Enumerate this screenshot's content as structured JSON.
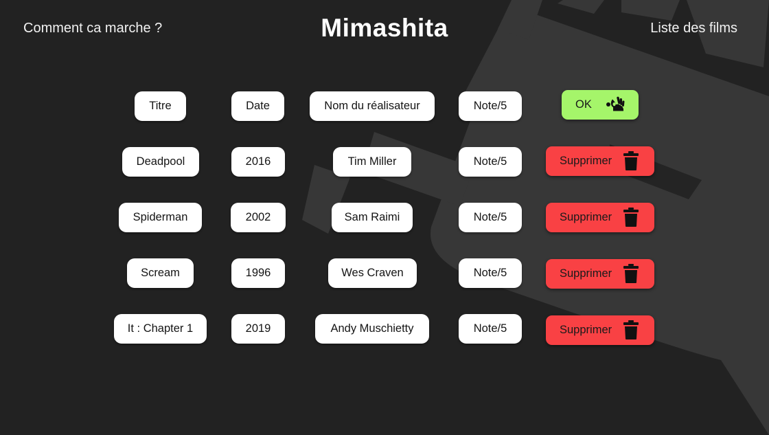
{
  "header": {
    "nav_left": "Comment ca marche ?",
    "brand": "Mimashita",
    "nav_right": "Liste des films"
  },
  "form": {
    "title_placeholder": "Titre",
    "date_placeholder": "Date",
    "director_placeholder": "Nom du réalisateur",
    "rating_placeholder": "Note/5",
    "submit_label": "OK",
    "submit_icon": "ok-hand-icon"
  },
  "films": [
    {
      "title": "Deadpool",
      "year": "2016",
      "director": "Tim Miller",
      "rating": "Note/5",
      "delete_label": "Supprimer"
    },
    {
      "title": "Spiderman",
      "year": "2002",
      "director": "Sam Raimi",
      "rating": "Note/5",
      "delete_label": "Supprimer"
    },
    {
      "title": "Scream",
      "year": "1996",
      "director": "Wes Craven",
      "rating": "Note/5",
      "delete_label": "Supprimer"
    },
    {
      "title": "It : Chapter 1",
      "year": "2019",
      "director": "Andy Muschietty",
      "rating": "Note/5",
      "delete_label": "Supprimer"
    }
  ],
  "delete_icon": "trash-icon",
  "colors": {
    "background": "#222222",
    "decor": "#373737",
    "ok_green": "#a5f56a",
    "delete_red": "#f94144",
    "pill": "#ffffff"
  }
}
